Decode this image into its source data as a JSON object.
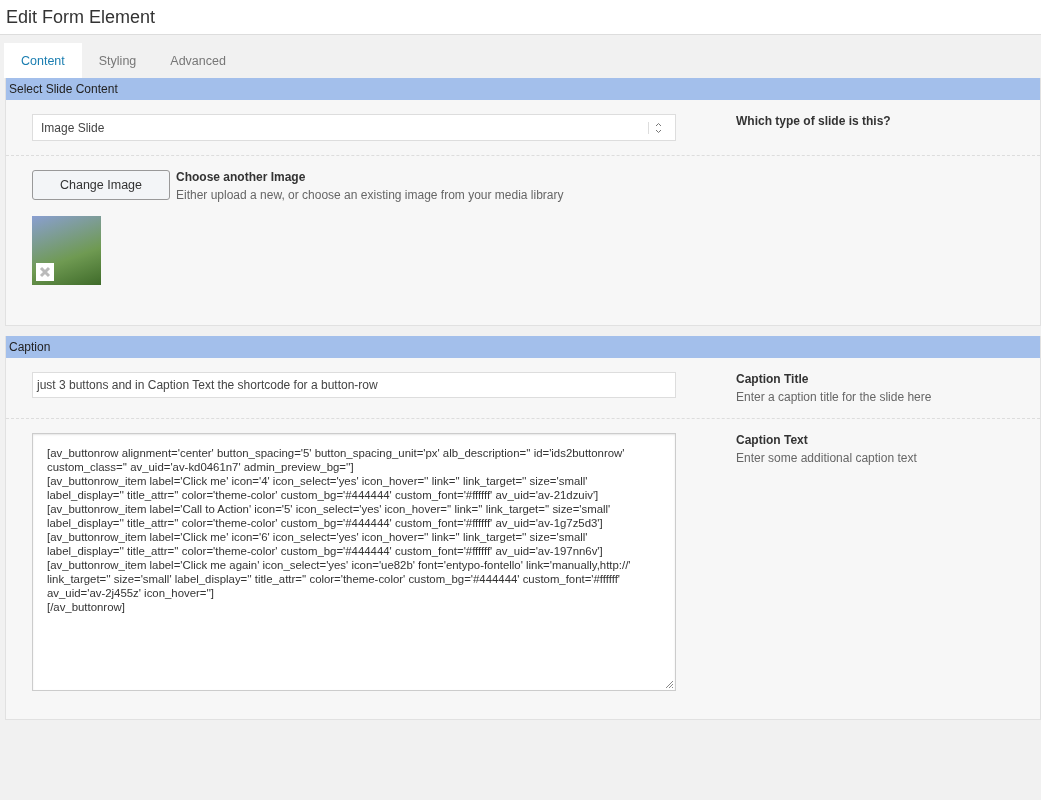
{
  "title": "Edit Form Element",
  "tabs": [
    {
      "label": "Content",
      "selected": true
    },
    {
      "label": "Styling",
      "selected": false
    },
    {
      "label": "Advanced",
      "selected": false
    }
  ],
  "sections": [
    {
      "heading": "Select Slide Content",
      "rows": [
        {
          "kind": "select",
          "value": "Image Slide",
          "label": "Which type of slide is this?"
        },
        {
          "kind": "image",
          "button": "Change Image",
          "label": "Choose another Image",
          "description": "Either upload a new, or choose an existing image from your media library"
        }
      ]
    },
    {
      "heading": "Caption",
      "rows": [
        {
          "kind": "input",
          "value": "just 3 buttons and in Caption Text the shortcode for a button-row",
          "label": "Caption Title",
          "description": "Enter a caption title for the slide here"
        },
        {
          "kind": "textarea",
          "lines": [
            "[av_buttonrow alignment='center' button_spacing='5' button_spacing_unit='px' alb_description='' id='ids2buttonrow' custom_class='' av_uid='av-kd0461n7' admin_preview_bg='']",
            "[av_buttonrow_item label='Click me' icon='4' icon_select='yes' icon_hover='' link='' link_target='' size='small' label_display='' title_attr='' color='theme-color' custom_bg='#444444' custom_font='#ffffff' av_uid='av-21dzuiv']",
            "[av_buttonrow_item label='Call to Action' icon='5' icon_select='yes' icon_hover='' link='' link_target='' size='small' label_display='' title_attr='' color='theme-color' custom_bg='#444444' custom_font='#ffffff' av_uid='av-1g7z5d3']",
            "[av_buttonrow_item label='Click me' icon='6' icon_select='yes' icon_hover='' link='' link_target='' size='small' label_display='' title_attr='' color='theme-color' custom_bg='#444444' custom_font='#ffffff' av_uid='av-197nn6v']",
            "[av_buttonrow_item label='Click me again' icon_select='yes' icon='ue82b' font='entypo-fontello' link='manually,http://' link_target='' size='small' label_display='' title_attr='' color='theme-color' custom_bg='#444444' custom_font='#ffffff' av_uid='av-2j455z' icon_hover='']",
            "[/av_buttonrow]"
          ],
          "label": "Caption Text",
          "description": "Enter some additional caption text"
        }
      ]
    }
  ]
}
